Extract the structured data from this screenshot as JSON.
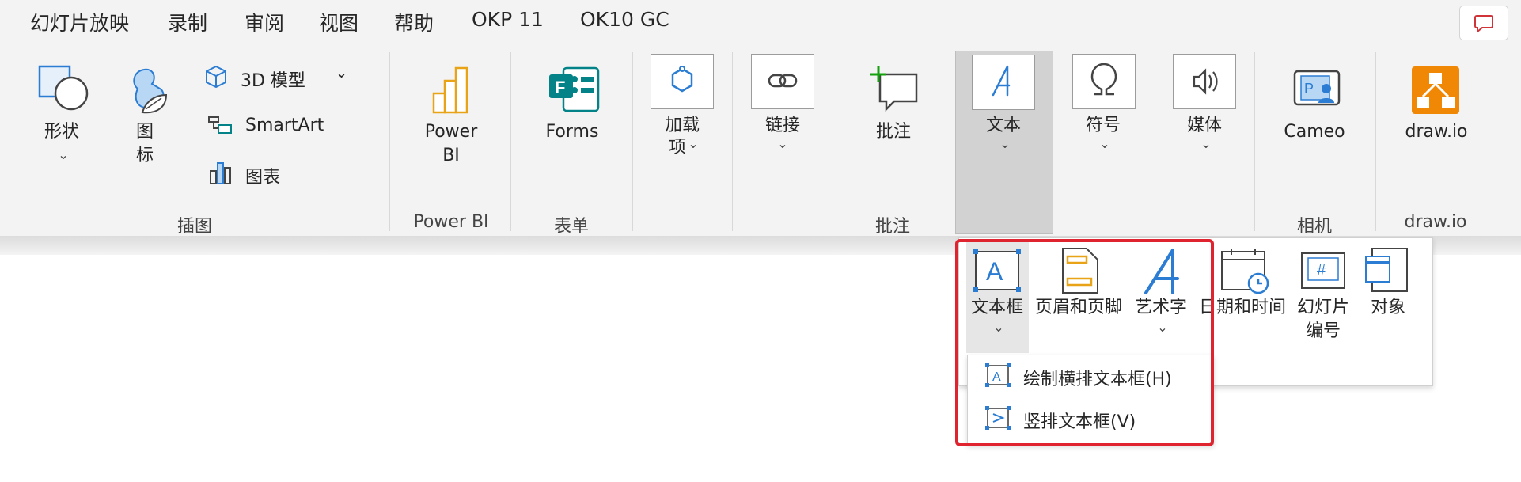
{
  "menu": [
    "幻灯片放映",
    "录制",
    "审阅",
    "视图",
    "帮助",
    "OKP 11",
    "OK10 GC"
  ],
  "ribbon": {
    "shapes_label": "形状",
    "icons_label_1": "图",
    "icons_label_2": "标",
    "model3d_label": "3D 模型",
    "smartart_label": "SmartArt",
    "chart_label": "图表",
    "illustrations_group": "插图",
    "powerbi_label_1": "Power",
    "powerbi_label_2": "BI",
    "powerbi_group": "Power BI",
    "forms_label": "Forms",
    "forms_group": "表单",
    "addins_label_1": "加载",
    "addins_label_2": "项",
    "links_label": "链接",
    "comment_label": "批注",
    "comment_group": "批注",
    "text_label": "文本",
    "symbols_label": "符号",
    "media_label": "媒体",
    "cameo_label": "Cameo",
    "camera_group": "相机",
    "drawio_label": "draw.io",
    "drawio_group": "draw.io"
  },
  "text_dropdown": {
    "textbox": "文本框",
    "header_footer": "页眉和页脚",
    "wordart": "艺术字",
    "datetime": "日期和时间",
    "slide_number_1": "幻灯片",
    "slide_number_2": "编号",
    "object": "对象"
  },
  "textbox_submenu": {
    "horizontal": "绘制横排文本框(H)",
    "vertical": "竖排文本框(V)"
  },
  "colors": {
    "accent_blue": "#2b7cd3",
    "highlight_red": "#e0242f",
    "drawio_orange": "#f08705",
    "forms_green": "#038387"
  }
}
